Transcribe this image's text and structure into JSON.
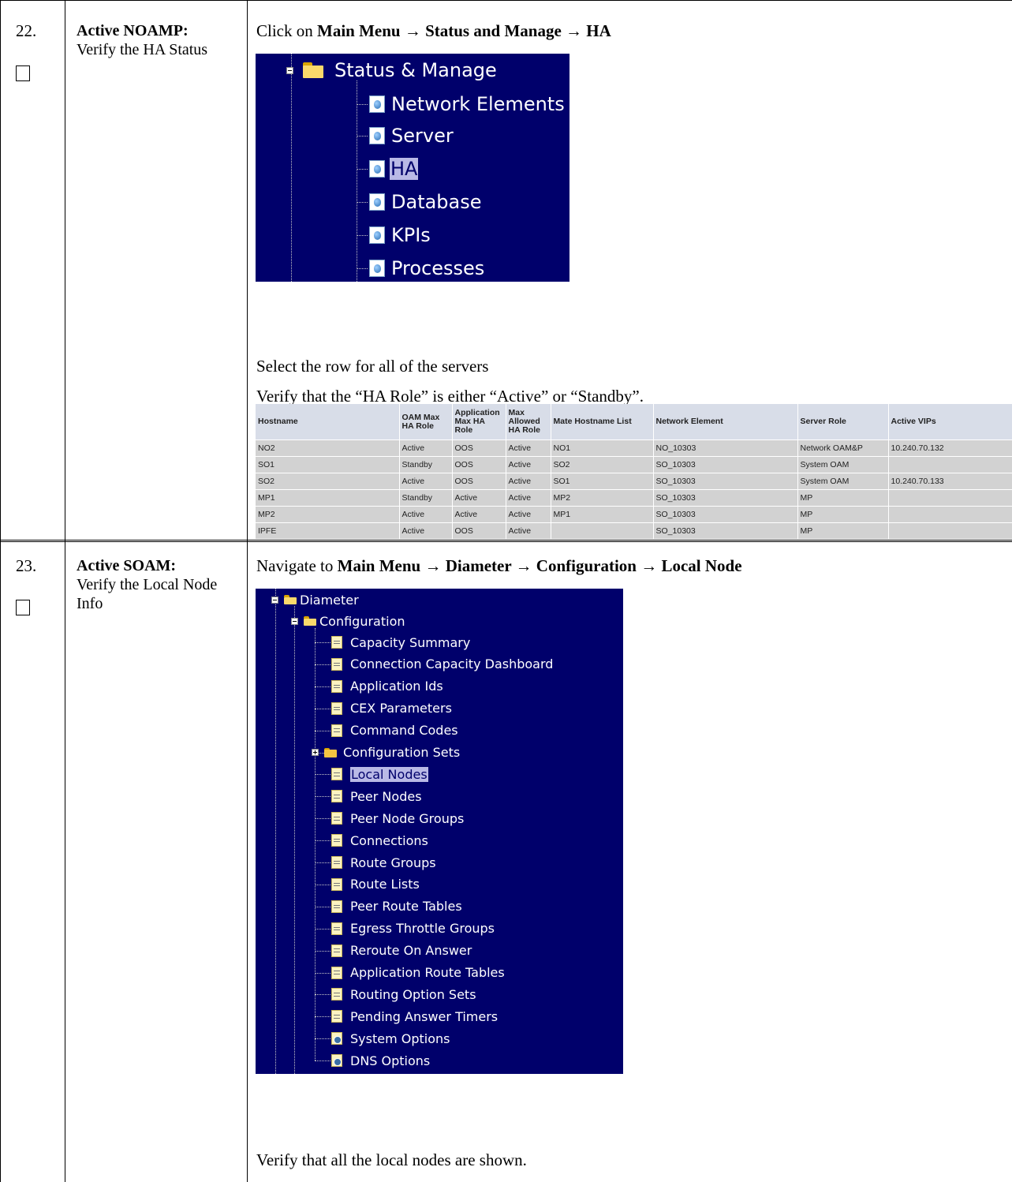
{
  "steps": [
    {
      "number": "22.",
      "title_bold": "Active NOAMP:",
      "title_rest": "Verify the HA Status",
      "instruction_prefix": "Click on ",
      "path": "Main Menu → Status and Manage → HA",
      "menu": {
        "root": "Status & Manage",
        "items": [
          "Network Elements",
          "Server",
          "HA",
          "Database",
          "KPIs",
          "Processes"
        ],
        "selected": "HA"
      },
      "text_1": "Select the row for all of the servers",
      "text_2": "Verify that the “HA Role” is either “Active” or “Standby”.",
      "ha_table": {
        "headers": [
          "Hostname",
          "OAM Max HA Role",
          "Application Max HA Role",
          "Max Allowed HA Role",
          "Mate Hostname List",
          "Network Element",
          "Server Role",
          "Active VIPs"
        ],
        "rows": [
          [
            "NO2",
            "Active",
            "OOS",
            "Active",
            "NO1",
            "NO_10303",
            "Network OAM&P",
            "10.240.70.132"
          ],
          [
            "SO1",
            "Standby",
            "OOS",
            "Active",
            "SO2",
            "SO_10303",
            "System OAM",
            ""
          ],
          [
            "SO2",
            "Active",
            "OOS",
            "Active",
            "SO1",
            "SO_10303",
            "System OAM",
            "10.240.70.133"
          ],
          [
            "MP1",
            "Standby",
            "Active",
            "Active",
            "MP2",
            "SO_10303",
            "MP",
            ""
          ],
          [
            "MP2",
            "Active",
            "Active",
            "Active",
            "MP1",
            "SO_10303",
            "MP",
            ""
          ],
          [
            "IPFE",
            "Active",
            "OOS",
            "Active",
            "",
            "SO_10303",
            "MP",
            ""
          ]
        ]
      }
    },
    {
      "number": "23.",
      "title_bold": "Active SOAM:",
      "title_rest": "Verify the Local Node Info",
      "instruction_prefix": "Navigate to ",
      "path": "Main Menu → Diameter → Configuration → Local Node",
      "menu": {
        "root": "Diameter",
        "folder": "Configuration",
        "items": [
          "Capacity Summary",
          "Connection Capacity Dashboard",
          "Application Ids",
          "CEX Parameters",
          "Command Codes",
          "Configuration Sets",
          "Local Nodes",
          "Peer Nodes",
          "Peer Node Groups",
          "Connections",
          "Route Groups",
          "Route Lists",
          "Peer Route Tables",
          "Egress Throttle Groups",
          "Reroute On Answer",
          "Application Route Tables",
          "Routing Option Sets",
          "Pending Answer Timers",
          "System Options",
          "DNS Options"
        ],
        "selected": "Local Nodes"
      },
      "text_1": "Verify that all the local nodes are shown."
    }
  ]
}
